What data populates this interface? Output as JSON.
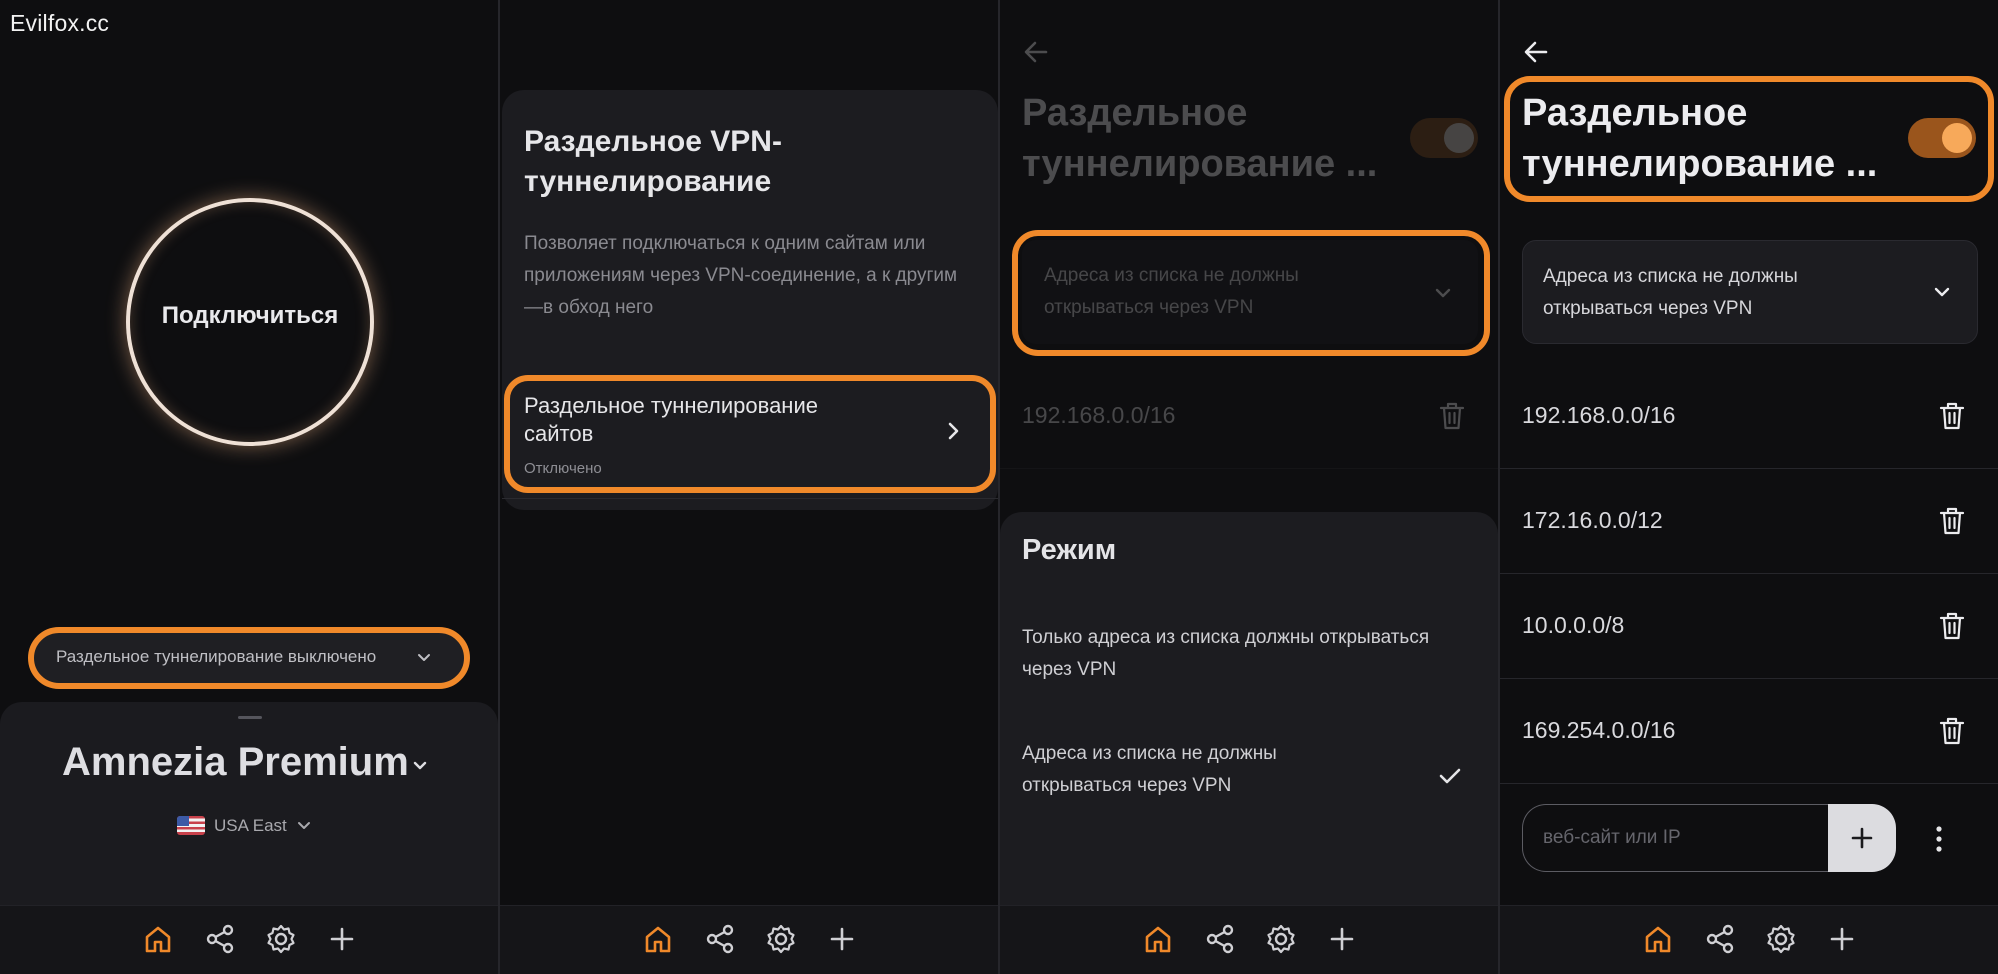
{
  "watermark": "Evilfox.cc",
  "colors": {
    "accent": "#f0892a",
    "background": "#0e0e10",
    "sheet": "#1c1c20",
    "toggle_on_knob": "#f7a95a"
  },
  "nav": {
    "icons": [
      "home-icon",
      "share-icon",
      "settings-icon",
      "plus-icon"
    ],
    "active": "home-icon"
  },
  "screen1": {
    "connect_label": "Подключиться",
    "split_status": "Раздельное туннелирование выключено",
    "server_name": "Amnezia Premium",
    "region": "USA East"
  },
  "screen2": {
    "title": "Раздельное VPN-туннелирование",
    "description": "Позволяет подключаться к одним сайтам или приложениям через VPN-соединение, а к другим—в обход него",
    "item_title": "Раздельное туннелирование сайтов",
    "item_status": "Отключено"
  },
  "screen3": {
    "title": "Раздельное туннелирование ...",
    "mode_selected": "Адреса из списка не должны открываться через VPN",
    "first_ip": "192.168.0.0/16",
    "sheet_title": "Режим",
    "options": [
      {
        "label": "Только адреса из списка должны открываться через VPN",
        "selected": false
      },
      {
        "label": "Адреса из списка не должны открываться через VPN",
        "selected": true
      }
    ]
  },
  "screen4": {
    "title": "Раздельное туннелирование ...",
    "toggle_on": true,
    "mode_selected": "Адреса из списка не должны открываться через VPN",
    "ips": [
      "192.168.0.0/16",
      "172.16.0.0/12",
      "10.0.0.0/8",
      "169.254.0.0/16"
    ],
    "input_placeholder": "веб-сайт или IP"
  }
}
